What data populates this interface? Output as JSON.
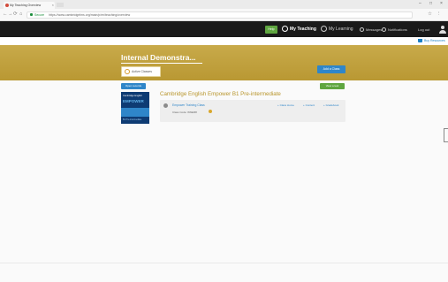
{
  "browser": {
    "tab_title": "My Teaching Overview",
    "tab_close": "×",
    "url_secure": "Secure",
    "url": "https://www.cambridgelms.org/main/p/en/teaching/overview",
    "window_controls": [
      "–",
      "□",
      "×"
    ],
    "nav_buttons": [
      "←",
      "→",
      "⟳",
      "⌂"
    ]
  },
  "topnav": {
    "help": "Help",
    "my_teaching": "My Teaching",
    "my_learning": "My Learning",
    "messages": "Messages",
    "notifications": "Notifications",
    "logout": "Log out",
    "icons": [
      "teaching-icon",
      "learning-icon",
      "messages-icon",
      "notifications-icon",
      "user-icon"
    ]
  },
  "buy": {
    "label": "Buy Resources"
  },
  "banner": {
    "org_name": "Internal Demonstra...",
    "active_tab": "Active Classes",
    "add_class": "Add a Class"
  },
  "actions": {
    "open_records": "Open records",
    "view_test": "View a test"
  },
  "course": {
    "title": "Cambridge English Empower B1 Pre-intermediate",
    "cover": {
      "line1": "Cambridge English",
      "line2": "EMPOWER",
      "line3": "B1 Pre-intermediate"
    },
    "class": {
      "name": "Empower Training Class",
      "code": "Class Code: W6EM8",
      "actions": [
        "+ Class Home",
        "+ Content",
        "+ Gradebook"
      ]
    }
  },
  "colors": {
    "banner": "#bfa13d",
    "primary_blue": "#2f86c9",
    "green": "#5fa640",
    "course_title": "#b8952b",
    "topnav": "#1a1a1a"
  }
}
